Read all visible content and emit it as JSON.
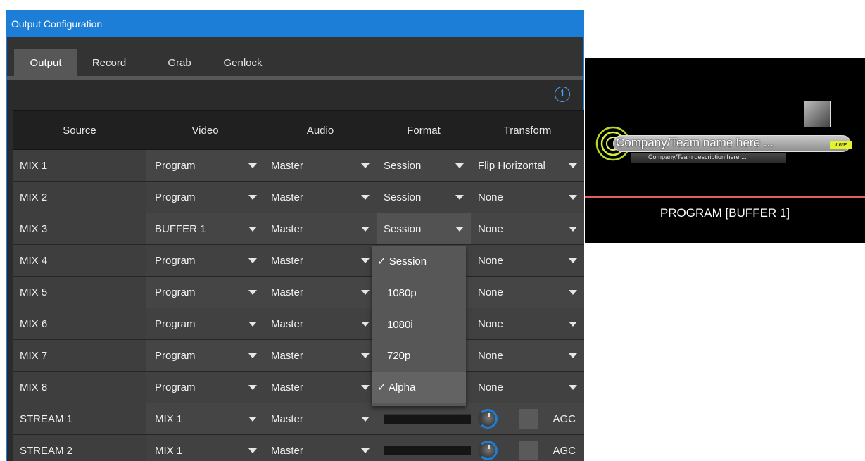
{
  "dialog": {
    "title": "Output Configuration",
    "tabs": [
      "Output",
      "Record",
      "Grab",
      "Genlock"
    ],
    "active_tab": "Output",
    "info_icon": "i"
  },
  "table": {
    "headers": [
      "Source",
      "Video",
      "Audio",
      "Format",
      "Transform"
    ],
    "rows": [
      {
        "source": "MIX 1",
        "video": "Program",
        "audio": "Master",
        "format": "Session",
        "transform": "Flip Horizontal"
      },
      {
        "source": "MIX 2",
        "video": "Program",
        "audio": "Master",
        "format": "Session",
        "transform": "None"
      },
      {
        "source": "MIX 3",
        "video": "BUFFER 1",
        "audio": "Master",
        "format": "Session",
        "transform": "None"
      },
      {
        "source": "MIX 4",
        "video": "Program",
        "audio": "Master",
        "format": "",
        "transform": "None"
      },
      {
        "source": "MIX 5",
        "video": "Program",
        "audio": "Master",
        "format": "",
        "transform": "None"
      },
      {
        "source": "MIX 6",
        "video": "Program",
        "audio": "Master",
        "format": "",
        "transform": "None"
      },
      {
        "source": "MIX 7",
        "video": "Program",
        "audio": "Master",
        "format": "",
        "transform": "None"
      },
      {
        "source": "MIX 8",
        "video": "Program",
        "audio": "Master",
        "format": "",
        "transform": "None"
      },
      {
        "source": "STREAM 1",
        "video": "MIX 1",
        "audio": "Master",
        "agc": "AGC"
      },
      {
        "source": "STREAM 2",
        "video": "MIX 1",
        "audio": "Master",
        "agc": "AGC"
      }
    ]
  },
  "format_dropdown": {
    "options": [
      "Session",
      "1080p",
      "1080i",
      "720p",
      "Alpha"
    ],
    "checked": [
      "Session",
      "Alpha"
    ],
    "checkmark": "✓"
  },
  "preview": {
    "label": "PROGRAM [BUFFER 1]",
    "lower_third_name": "Company/Team name here ...",
    "lower_third_desc": "Company/Team description here ...",
    "live_badge": "LIVE"
  },
  "colors": {
    "accent": "#1c7ed6",
    "panel": "#2b2b2b",
    "tab_active": "#575757",
    "tally_line": "#e06060"
  }
}
